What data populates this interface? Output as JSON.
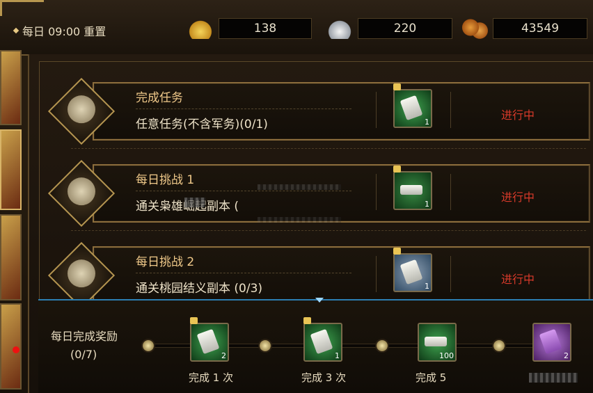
{
  "header": {
    "reset_text": "每日 09:00 重置",
    "currencies": [
      {
        "icon": "gold-ingot-icon",
        "value": "138"
      },
      {
        "icon": "silver-ingot-icon",
        "value": "220"
      },
      {
        "icon": "copper-coins-icon",
        "value": "43549"
      }
    ]
  },
  "tasks": [
    {
      "title": "完成任务",
      "desc": "任意任务(不含军务)(0/1)",
      "reward_count": "1",
      "status": "进行中",
      "icon": "scroll-icon"
    },
    {
      "title": "每日挑战 1",
      "desc": "通关枭雄崛起副本 (",
      "reward_count": "1",
      "status": "进行中",
      "icon": "blade-icon"
    },
    {
      "title": "每日挑战 2",
      "desc": "通关桃园结义副本 (0/3)",
      "reward_count": "1",
      "status": "进行中",
      "icon": "blade-icon"
    }
  ],
  "reward": {
    "label": "每日完成奖励",
    "progress": "(0/7)",
    "tiers": [
      {
        "text": "完成 1 次",
        "count": "2"
      },
      {
        "text": "完成 3 次",
        "count": "1"
      },
      {
        "text": "完成 5 ",
        "count": "100"
      },
      {
        "text": "",
        "count": "2"
      }
    ]
  },
  "colors": {
    "status": "#d93a2a",
    "title": "#f0c98a",
    "accent_blue": "#2c7fb3"
  }
}
